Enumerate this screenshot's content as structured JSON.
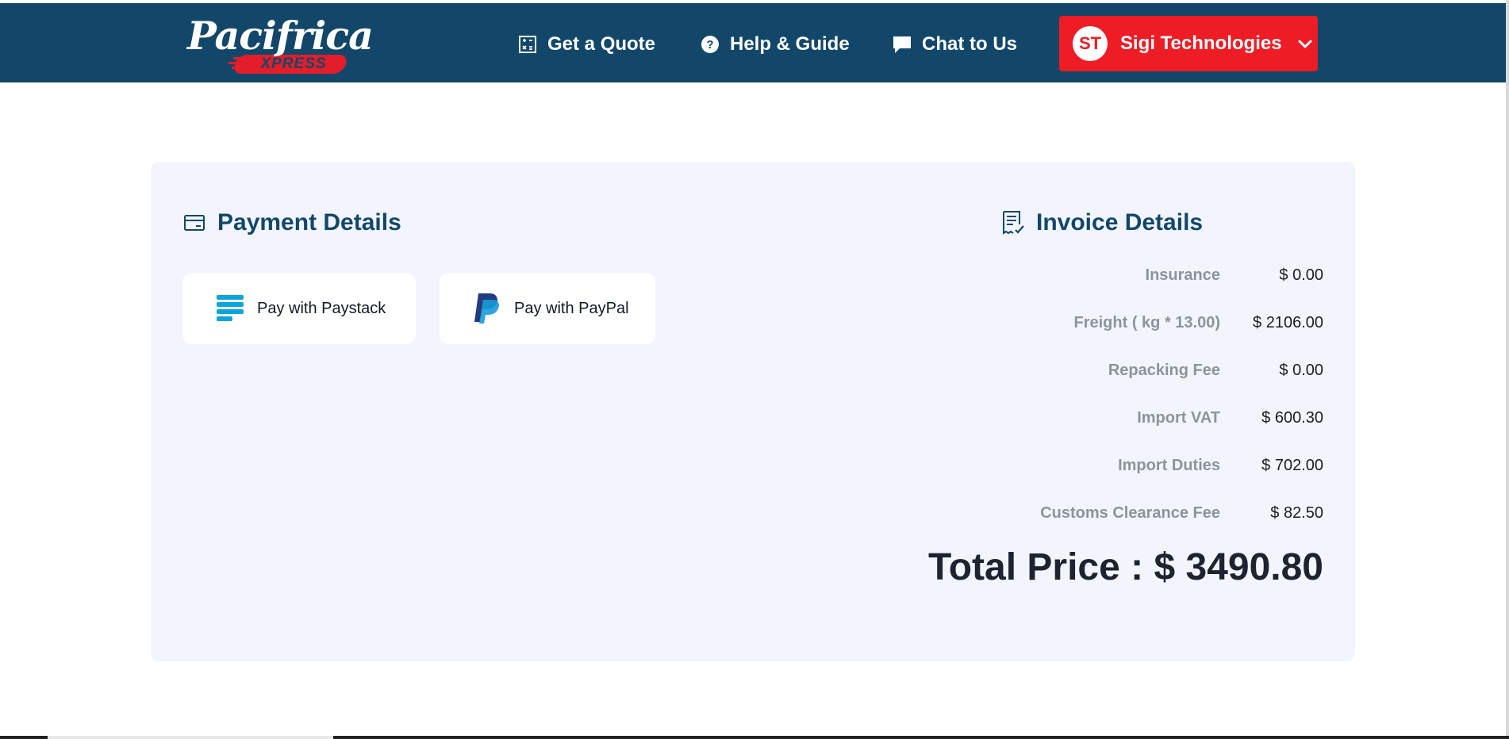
{
  "brand": {
    "name": "Pacifrica",
    "tagline": "XPRESS",
    "colors": {
      "navy": "#124769",
      "red": "#ee1c25",
      "panel": "#f2f5fd"
    }
  },
  "nav": {
    "quote": {
      "label": "Get a Quote",
      "icon": "calculator-icon"
    },
    "help": {
      "label": "Help & Guide",
      "icon": "question-circle-icon"
    },
    "chat": {
      "label": "Chat to Us",
      "icon": "chat-bubble-icon"
    }
  },
  "user": {
    "initials": "ST",
    "name": "Sigi Technologies",
    "icon": "chevron-down-icon"
  },
  "payment": {
    "title": "Payment Details",
    "icon": "credit-card-icon",
    "paystack_label": "Pay with Paystack",
    "paypal_label": "Pay with PayPal"
  },
  "invoice": {
    "title": "Invoice Details",
    "icon": "receipt-icon",
    "rows": [
      {
        "label": "Insurance",
        "value": "$ 0.00"
      },
      {
        "label": "Freight ( kg * 13.00)",
        "value": "$ 2106.00"
      },
      {
        "label": "Repacking Fee",
        "value": "$ 0.00"
      },
      {
        "label": "Import VAT",
        "value": "$ 600.30"
      },
      {
        "label": "Import Duties",
        "value": "$ 702.00"
      },
      {
        "label": "Customs Clearance Fee",
        "value": "$ 82.50"
      }
    ],
    "total": "Total Price : $ 3490.80"
  }
}
